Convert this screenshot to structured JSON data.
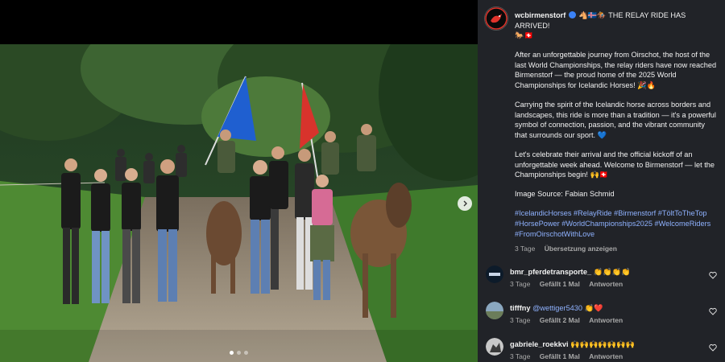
{
  "post": {
    "username": "wcbirmenstorf",
    "headline": "THE RELAY RIDE HAS ARRIVED!",
    "headline_emoji": "🐴🇮🇸🏇",
    "headline_emoji_2": "🐎🇨🇭",
    "paragraph_1": "After an unforgettable journey from Oirschot, the host of the last World Championships, the relay riders have now reached Birmenstorf — the proud home of the 2025 World Championships for Icelandic Horses! 🎉🔥",
    "paragraph_2": "Carrying the spirit of the Icelandic horse across borders and landscapes, this ride is more than a tradition — it's a powerful symbol of connection, passion, and the vibrant community that surrounds our sport. 💙",
    "paragraph_3": "Let's celebrate their arrival and the official kickoff of an unforgettable week ahead. Welcome to Birmenstorf — let the Championships begin! 🙌🇨🇭",
    "image_source": "Image Source: Fabian Schmid",
    "hashtags": [
      "#IcelandicHorses",
      "#RelayRide",
      "#Birmenstorf",
      "#TöltToTheTop",
      "#HorsePower",
      "#WorldChampionships2025",
      "#WelcomeRiders",
      "#FromOirschotWithLove"
    ],
    "time": "3 Tage",
    "translate": "Übersetzung anzeigen"
  },
  "comments": [
    {
      "username": "bmr_pferdetransporte_",
      "text": "👏👏👏👏",
      "time": "3 Tage",
      "likes": "Gefällt 1 Mal",
      "reply": "Antworten"
    },
    {
      "username": "tifffny",
      "mention": "@wettiger5430",
      "text": "👏❤️",
      "time": "3 Tage",
      "likes": "Gefällt 2 Mal",
      "reply": "Antworten"
    },
    {
      "username": "gabriele_roekkvi",
      "text": "🙌🙌🙌🙌🙌🙌🙌",
      "time": "3 Tage",
      "likes": "Gefällt 1 Mal",
      "reply": "Antworten"
    }
  ],
  "carousel": {
    "slides": 3,
    "current": 1
  },
  "colors": {
    "panel": "#212328",
    "hashtag": "#8fb2ff",
    "verified": "#3b82f6",
    "muted": "#a8a8a8"
  },
  "icons": [
    "chevron-right-icon",
    "heart-icon",
    "verified-badge-icon"
  ]
}
